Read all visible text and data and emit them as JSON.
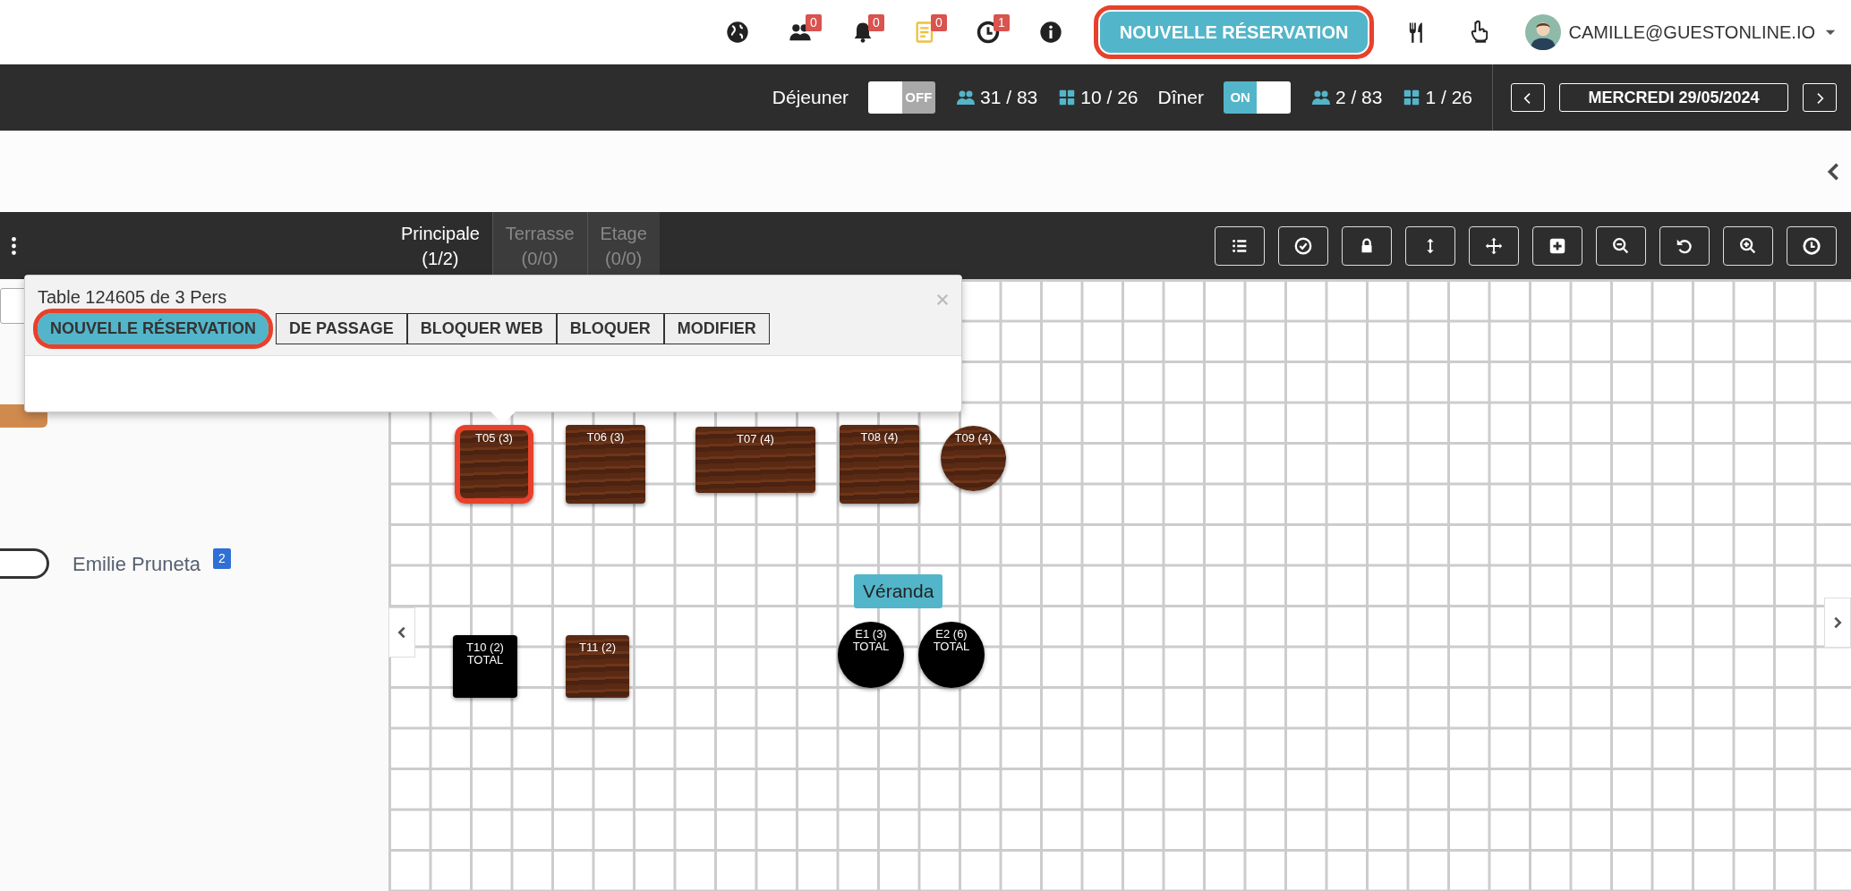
{
  "top_bar": {
    "icons": [
      {
        "kind": "globe"
      },
      {
        "kind": "people",
        "badge": "0"
      },
      {
        "kind": "bell",
        "badge": "0"
      },
      {
        "kind": "notes",
        "badge": "0"
      },
      {
        "kind": "clock",
        "badge": "1"
      },
      {
        "kind": "info"
      }
    ],
    "new_booking": {
      "label": "NOUVELLE RÉSERVATION",
      "highlighted": true
    },
    "tools": [
      {
        "kind": "cutlery"
      },
      {
        "kind": "hand"
      }
    ],
    "user": {
      "email": "CAMILLE@GUESTONLINE.IO"
    }
  },
  "services": [
    {
      "name": "Déjeuner",
      "on": false,
      "switch_label": "OFF",
      "guests": "31 / 83",
      "tables": "10 / 26"
    },
    {
      "name": "Dîner",
      "on": true,
      "switch_label": "ON",
      "guests": "2 / 83",
      "tables": "1 / 26"
    }
  ],
  "date": "MERCREDI 29/05/2024",
  "floor_tabs": [
    {
      "name": "Principale",
      "count": "(1/2)",
      "selected": true
    },
    {
      "name": "Terrasse",
      "count": "(0/0)",
      "selected": false
    },
    {
      "name": "Etage",
      "count": "(0/0)",
      "selected": false
    }
  ],
  "toolbar": [
    {
      "kind": "list"
    },
    {
      "kind": "check"
    },
    {
      "kind": "lock"
    },
    {
      "kind": "resize"
    },
    {
      "kind": "move"
    },
    {
      "kind": "add"
    },
    {
      "kind": "zoom-out"
    },
    {
      "kind": "undo"
    },
    {
      "kind": "zoom-in"
    },
    {
      "kind": "clock"
    }
  ],
  "popup": {
    "title": "Table 124605 de 3 Pers",
    "buttons": [
      {
        "label": "NOUVELLE RÉSERVATION",
        "highlighted": true
      },
      {
        "label": "DE PASSAGE",
        "highlighted": false
      },
      {
        "label": "BLOQUER WEB",
        "highlighted": false
      },
      {
        "label": "BLOQUER",
        "highlighted": false
      },
      {
        "label": "MODIFIER",
        "highlighted": false
      }
    ]
  },
  "booking_list": [
    {
      "guest": "Emilie Pruneta",
      "badge": "2"
    }
  ],
  "area_label": "Véranda",
  "tables": [
    {
      "label": "T05 (3)",
      "kind": "square",
      "full": false,
      "highlighted": true
    },
    {
      "label": "T06 (3)",
      "kind": "square",
      "full": false,
      "highlighted": false
    },
    {
      "label": "T07 (4)",
      "kind": "rect",
      "full": false,
      "highlighted": false
    },
    {
      "label": "T08 (4)",
      "kind": "square",
      "full": false,
      "highlighted": false
    },
    {
      "label": "T09 (4)",
      "kind": "round",
      "full": false,
      "highlighted": false
    },
    {
      "label": "T10 (2)",
      "status": "TOTAL",
      "kind": "square",
      "full": true,
      "highlighted": false
    },
    {
      "label": "T11 (2)",
      "kind": "square",
      "full": false,
      "highlighted": false
    },
    {
      "label": "E1 (3)",
      "status": "TOTAL",
      "kind": "round",
      "full": true,
      "highlighted": false
    },
    {
      "label": "E2 (6)",
      "status": "TOTAL",
      "kind": "round",
      "full": true,
      "highlighted": false
    }
  ]
}
